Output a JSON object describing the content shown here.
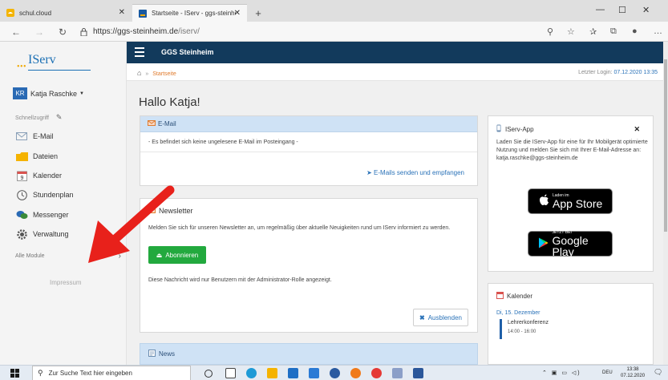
{
  "browser": {
    "tabs": [
      {
        "title": "schul.cloud",
        "active": false
      },
      {
        "title": "Startseite - IServ - ggs-steinheim",
        "active": true
      }
    ],
    "url_host": "https://ggs-steinheim.de",
    "url_path": "/iserv/"
  },
  "sidebar": {
    "logo": "IServ",
    "user_initials": "KR",
    "user_name": "Katja Raschke",
    "quick_access": "Schnellzugriff",
    "items": [
      {
        "label": "E-Mail",
        "icon": "envelope-icon"
      },
      {
        "label": "Dateien",
        "icon": "folder-icon"
      },
      {
        "label": "Kalender",
        "icon": "calendar-icon"
      },
      {
        "label": "Stundenplan",
        "icon": "clock-icon"
      },
      {
        "label": "Messenger",
        "icon": "chat-icon"
      },
      {
        "label": "Verwaltung",
        "icon": "gear-icon"
      }
    ],
    "all_modules": "Alle Module",
    "imprint": "Impressum"
  },
  "header": {
    "school_name": "GGS Steinheim",
    "breadcrumb": "Startseite",
    "last_login_label": "Letzter Login:",
    "last_login_value": "07.12.2020 13:35"
  },
  "main": {
    "greeting": "Hallo Katja!",
    "email_panel": {
      "title": "E-Mail",
      "message": "- Es befindet sich keine ungelesene E-Mail im Posteingang -",
      "link": "E-Mails senden und empfangen"
    },
    "newsletter_panel": {
      "title": "Newsletter",
      "text": "Melden Sie sich für unseren Newsletter an, um regelmäßig über aktuelle Neuigkeiten rund um IServ informiert zu werden.",
      "subscribe": "Abonnieren",
      "note": "Diese Nachricht wird nur Benutzern mit der Administrator-Rolle angezeigt.",
      "hide": "Ausblenden"
    },
    "news_panel": {
      "title": "News"
    },
    "app_panel": {
      "title": "IServ-App",
      "text": "Laden Sie die IServ-App für eine für Ihr Mobilgerät optimierte Nutzung und melden Sie sich mit Ihrer E-Mail-Adresse an: katja.raschke@ggs-steinheim.de",
      "appstore_small": "Laden im",
      "appstore_big": "App Store",
      "play_small": "JETZT BEI",
      "play_big": "Google Play"
    },
    "calendar_panel": {
      "title": "Kalender",
      "date": "Di, 15. Dezember",
      "event": "Lehrerkonferenz",
      "time": "14:00 - 16:00"
    }
  },
  "taskbar": {
    "search_placeholder": "Zur Suche Text hier eingeben",
    "language": "DEU",
    "time": "13:38",
    "date": "07.12.2020"
  },
  "colors": {
    "topbar": "#123a5c",
    "panel_header": "#cfe2f5",
    "link": "#2a72b8",
    "button_green": "#22a93e",
    "annotation_arrow": "#e8211b"
  }
}
